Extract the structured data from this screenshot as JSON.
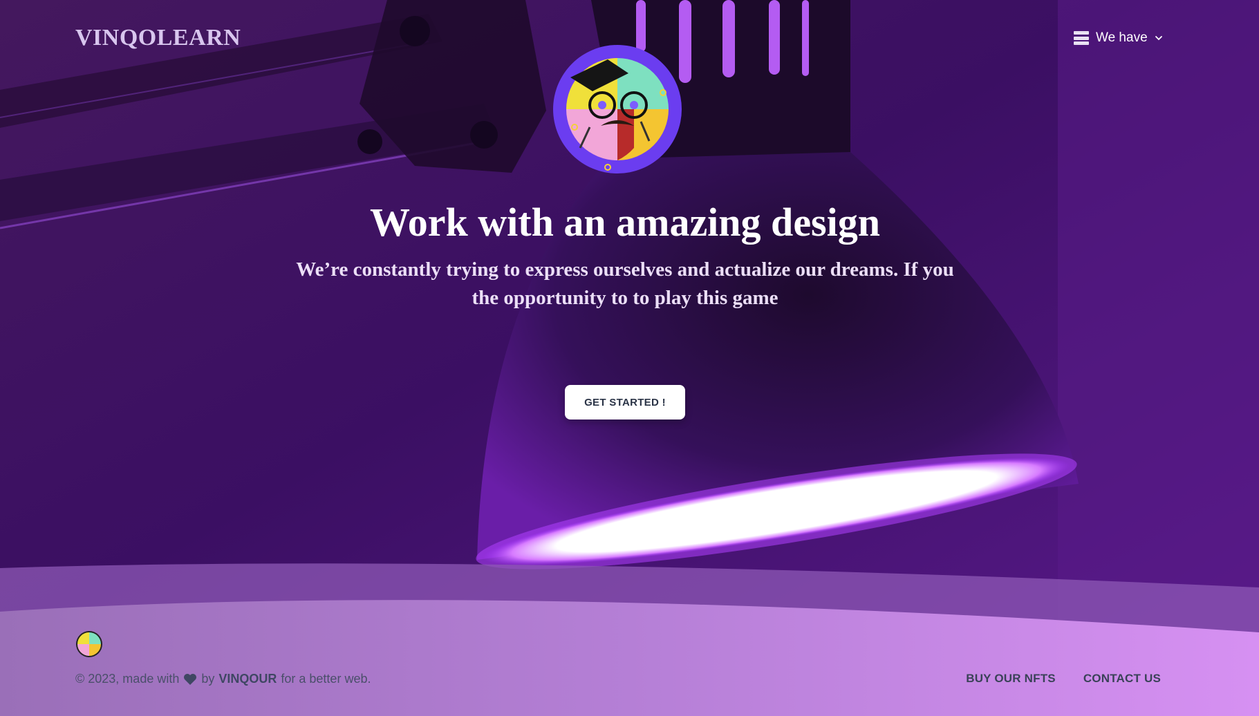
{
  "brand": {
    "name": "VINQOLEARN"
  },
  "nav": {
    "menu_label": "We have"
  },
  "hero": {
    "title": "Work with an amazing design",
    "subtitle": "We’re constantly trying to express ourselves and actualize our dreams. If you the opportunity to to play this game",
    "cta_label": "GET STARTED !"
  },
  "footer": {
    "copyright_prefix": "© 2023, made with",
    "by": "by",
    "author": "VINQOUR",
    "suffix": "for a better web.",
    "links": [
      {
        "label": "BUY OUR NFTS"
      },
      {
        "label": "CONTACT US"
      }
    ]
  },
  "icons": {
    "menu": "menu-icon",
    "chevron": "chevron-down-icon",
    "heart": "heart-icon"
  },
  "colors": {
    "background_purple": "#3a1160",
    "lamp_glow": "#c060ff",
    "cta_background": "#ffffff",
    "footer_text": "#4a4f6a"
  }
}
